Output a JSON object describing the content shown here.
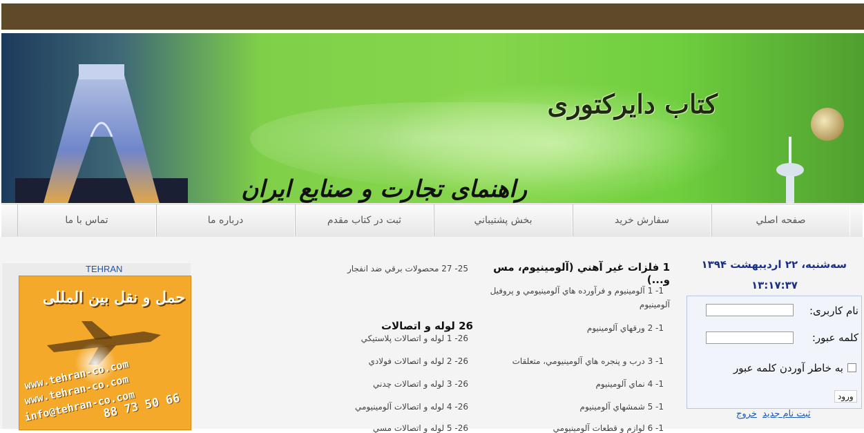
{
  "site": {
    "title": "کتاب دایرکتوری",
    "subtitle": "راهنمای تجارت و صنایع ایران"
  },
  "nav": {
    "items": [
      "صفحه اصلي",
      "سفارش خريد",
      "بخش پشتيباني",
      "ثبت در کتاب مقدم",
      "درباره ما",
      "تماس با ما"
    ]
  },
  "sidebar_left": {
    "city_label": "TEHRAN",
    "ad_title": "حمل و نقل بین المللی",
    "ad_lines": [
      "www.tehran-co.com",
      "www.tehran-co.com",
      "info@tehran-co.com",
      "88 73 50 66"
    ]
  },
  "categories": {
    "col1": {
      "title_line1": "1 فلزات غير آهني (آلومينيوم، مس",
      "title_line2": "و...)",
      "items": [
        "1- 1 آلومينيوم و فرآورده هاي آلومينيومي و پروفيل",
        "آلومينيوم",
        "1- 2 ورقهاي آلومينيوم",
        "1- 3 درب و پنجره هاي آلومينيومي، متعلقات",
        "1- 4 نماي آلومينيوم",
        "1- 5 شمشهاي آلومينيوم",
        "1- 6 لوازم و قطعات آلومينيومي"
      ]
    },
    "col2": {
      "top_item": "25- 27 محصولات برقي ضد انفجار",
      "title": "26 لوله و اتصالات",
      "items": [
        "26- 1 لوله و اتصالات پلاستيکي",
        "26- 2 لوله و اتصالات فولادي",
        "26- 3 لوله و اتصالات چدني",
        "26- 4 لوله و اتصالات آلومينيومي",
        "26- 5 لوله و اتصالات مسي"
      ]
    }
  },
  "sidebar_right": {
    "date": "سه‌شنبه، ۲۲ اردیبهشت ۱۳۹۴",
    "time": "۱۳:۱۷:۳۷",
    "login": {
      "username_label": "نام کاربری:",
      "password_label": "کلمه عبور:",
      "remember_label": "به خاطر آوردن کلمه عبور",
      "submit_label": "ورود",
      "register_link": "ثبت نام جديد",
      "logout_link": "خروج"
    }
  }
}
